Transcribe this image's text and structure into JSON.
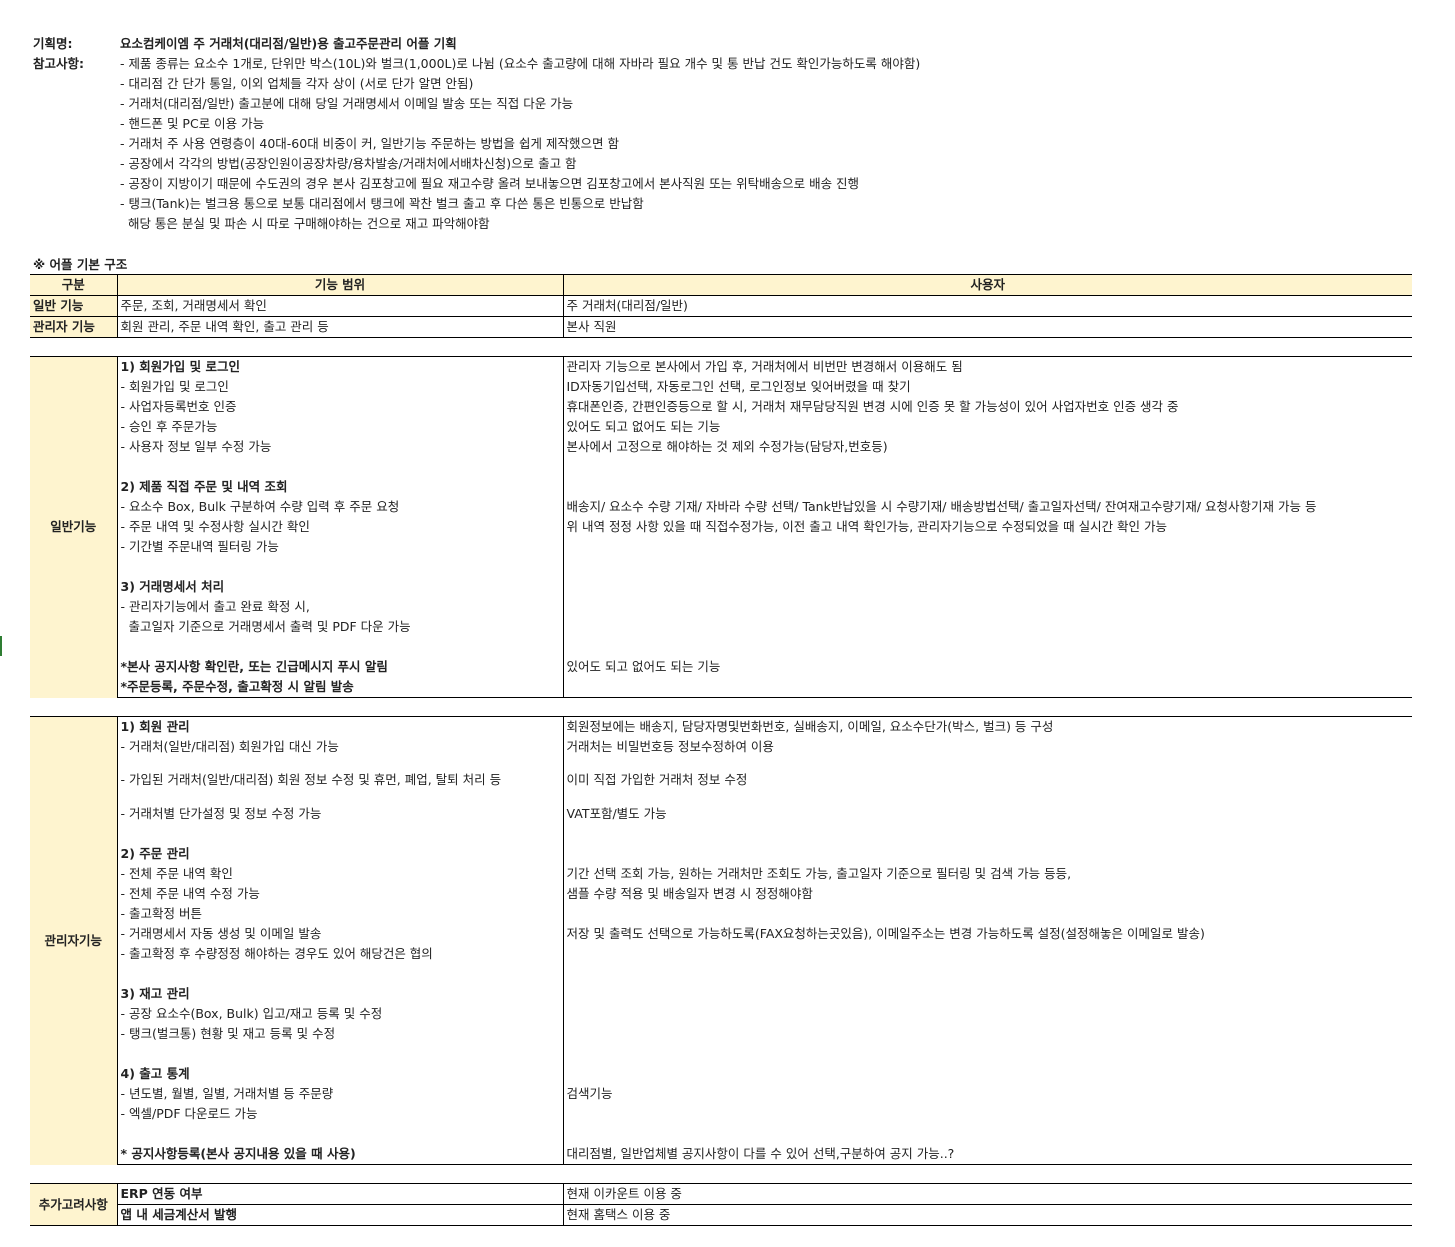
{
  "header": {
    "title_label": "기획명:",
    "title_value": "요소컴케이엠 주 거래처(대리점/일반)용 출고주문관리 어플 기획",
    "notes_label": "참고사항:",
    "notes": [
      "- 제품 종류는 요소수 1개로, 단위만 박스(10L)와 벌크(1,000L)로 나뉨 (요소수 출고량에 대해 자바라 필요 개수 및 통 반납 건도 확인가능하도록 해야함)",
      "- 대리점 간 단가 통일, 이외 업체들 각자 상이 (서로 단가 알면 안됨)",
      "- 거래처(대리점/일반) 출고분에 대해 당일 거래명세서 이메일 발송 또는 직접 다운 가능",
      "- 핸드폰 및 PC로 이용 가능",
      "- 거래처 주 사용 연령층이 40대-60대 비중이 커, 일반기능 주문하는 방법을 쉽게 제작했으면 함",
      "- 공장에서 각각의 방법(공장인원이공장차량/용차발송/거래처에서배차신청)으로 출고 함",
      "- 공장이 지방이기 때문에 수도권의 경우 본사 김포창고에 필요 재고수량 올려 보내놓으면 김포창고에서 본사직원 또는 위탁배송으로 배송 진행",
      "- 탱크(Tank)는 벌크용 통으로 보통 대리점에서 탱크에 꽉찬 벌크 출고 후 다쓴 통은 빈통으로 반납함",
      "  해당 통은 분실 및 파손 시 따로 구매해야하는 건으로 재고 파악해야함"
    ]
  },
  "structure": {
    "section_title": "※ 어플 기본 구조",
    "columns": [
      "구분",
      "기능 범위",
      "사용자"
    ],
    "rows": [
      {
        "category": "일반 기능",
        "scope": "주문, 조회, 거래명세서 확인",
        "user": "주 거래처(대리점/일반)"
      },
      {
        "category": "관리자 기능",
        "scope": "회원 관리, 주문 내역 확인, 출고 관리 등",
        "user": "본사 직원"
      }
    ]
  },
  "general": {
    "category": "일반기능",
    "lines": [
      {
        "left": "1) 회원가입 및 로그인",
        "right": "관리자 기능으로 본사에서 가입 후, 거래처에서 비번만 변경해서 이용해도 됨",
        "bold": true
      },
      {
        "left": "- 회원가입 및 로그인",
        "right": "ID자동기입선택, 자동로그인 선택, 로그인정보 잊어버렸을 때 찾기"
      },
      {
        "left": "- 사업자등록번호 인증",
        "right": "휴대폰인증, 간편인증등으로 할 시, 거래처 재무담당직원 변경 시에 인증 못 할 가능성이 있어 사업자번호 인증 생각 중"
      },
      {
        "left": "- 승인 후 주문가능",
        "right": "있어도 되고 없어도 되는 기능"
      },
      {
        "left": "- 사용자 정보 일부 수정 가능",
        "right": "본사에서 고정으로 해야하는 것 제외 수정가능(담당자,번호등)"
      },
      {
        "left": "",
        "right": ""
      },
      {
        "left": "2) 제품 직접 주문 및 내역 조회",
        "right": "",
        "bold": true
      },
      {
        "left": "- 요소수 Box, Bulk 구분하여 수량 입력 후 주문 요청",
        "right": "배송지/ 요소수 수량 기재/ 자바라 수량 선택/ Tank반납있을 시 수량기재/ 배송방법선택/ 출고일자선택/ 잔여재고수량기재/ 요청사항기재 가능 등"
      },
      {
        "left": "- 주문 내역 및 수정사항 실시간 확인",
        "right": "위 내역 정정 사항 있을 때 직접수정가능, 이전 출고 내역 확인가능, 관리자기능으로 수정되었을 때 실시간 확인 가능"
      },
      {
        "left": "- 기간별 주문내역 필터링 가능",
        "right": ""
      },
      {
        "left": "",
        "right": ""
      },
      {
        "left": "3) 거래명세서 처리",
        "right": "",
        "bold": true
      },
      {
        "left": "- 관리자기능에서 출고 완료 확정 시,",
        "right": ""
      },
      {
        "left": "  출고일자 기준으로 거래명세서 출력 및 PDF 다운 가능",
        "right": ""
      },
      {
        "left": "",
        "right": ""
      },
      {
        "left": "*본사 공지사항 확인란, 또는 긴급메시지 푸시 알림",
        "right": "있어도 되고 없어도 되는 기능",
        "bold": true
      },
      {
        "left": "*주문등록, 주문수정, 출고확정 시 알림 발송",
        "right": "",
        "bold": true
      }
    ]
  },
  "admin": {
    "category": "관리자기능",
    "lines": [
      {
        "left": "1) 회원 관리",
        "right": "회원정보에는 배송지, 담당자명및번화번호, 실배송지, 이메일, 요소수단가(박스, 벌크) 등 구성",
        "bold": true
      },
      {
        "left": "- 거래처(일반/대리점) 회원가입 대신 가능",
        "right": "거래처는 비밀번호등 정보수정하여 이용"
      },
      {
        "left": "",
        "right": "",
        "h": 13
      },
      {
        "left": "- 가입된 거래처(일반/대리점) 회원 정보 수정 및 휴먼, 폐업, 탈퇴 처리 등",
        "right": "이미 직접 가입한 거래처 정보 수정"
      },
      {
        "left": "",
        "right": "",
        "h": 14
      },
      {
        "left": "- 거래처별 단가설정 및 정보 수정 가능",
        "right": "VAT포함/별도 가능"
      },
      {
        "left": "",
        "right": "",
        "h": 20
      },
      {
        "left": "2) 주문 관리",
        "right": "",
        "bold": true
      },
      {
        "left": "- 전체 주문 내역 확인",
        "right": "기간 선택 조회 가능, 원하는 거래처만 조회도 가능, 출고일자 기준으로 필터링 및 검색 가능 등등,"
      },
      {
        "left": "- 전체 주문 내역 수정 가능",
        "right": "샘플 수량 적용 및 배송일자 변경 시 정정해야함"
      },
      {
        "left": "- 출고확정 버튼",
        "right": ""
      },
      {
        "left": "- 거래명세서 자동 생성 및 이메일 발송",
        "right": "저장 및 출력도 선택으로 가능하도록(FAX요청하는곳있음), 이메일주소는 변경 가능하도록 설정(설정해놓은 이메일로 발송)"
      },
      {
        "left": "- 출고확정 후 수량정정 해야하는 경우도 있어 해당건은 협의",
        "right": ""
      },
      {
        "left": "",
        "right": ""
      },
      {
        "left": "3) 재고 관리",
        "right": "",
        "bold": true
      },
      {
        "left": "- 공장 요소수(Box, Bulk) 입고/재고 등록 및 수정",
        "right": ""
      },
      {
        "left": "- 탱크(벌크통) 현황 및 재고 등록 및 수정",
        "right": ""
      },
      {
        "left": "",
        "right": ""
      },
      {
        "left": "4) 출고 통계",
        "right": "",
        "bold": true
      },
      {
        "left": "- 년도별, 월별, 일별, 거래처별 등 주문량",
        "right": "검색기능"
      },
      {
        "left": "- 엑셀/PDF 다운로드 가능",
        "right": ""
      },
      {
        "left": "",
        "right": ""
      },
      {
        "left": "* 공지사항등록(본사 공지내용 있을 때 사용)",
        "right": "대리점별, 일반업체별 공지사항이 다를 수 있어 선택,구분하여 공지 가능..?",
        "bold": true
      }
    ]
  },
  "extra": {
    "category": "추가고려사항",
    "lines": [
      {
        "left": "ERP 연동 여부",
        "right": "현재 이카운트 이용 중",
        "bold": true
      },
      {
        "left": "앱 내 세금계산서 발행",
        "right": "현재 홈택스 이용 중",
        "bold": true
      }
    ]
  }
}
